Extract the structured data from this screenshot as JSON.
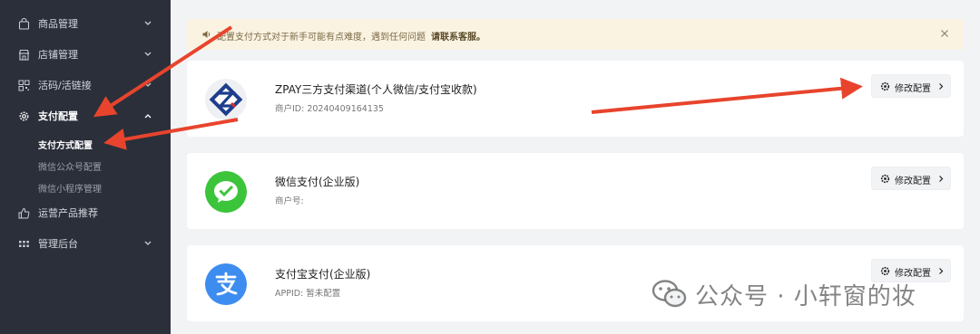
{
  "sidebar": {
    "items": [
      {
        "label": "商品管理",
        "icon": "bag-icon"
      },
      {
        "label": "店铺管理",
        "icon": "store-icon"
      },
      {
        "label": "活码/活链接",
        "icon": "qr-icon"
      },
      {
        "label": "支付配置",
        "icon": "gear-icon"
      },
      {
        "label": "运营产品推荐",
        "icon": "thumbs-up-icon"
      },
      {
        "label": "管理后台",
        "icon": "grid-icon"
      }
    ],
    "submenu": [
      {
        "label": "支付方式配置"
      },
      {
        "label": "微信公众号配置"
      },
      {
        "label": "微信小程序管理"
      }
    ]
  },
  "notice": {
    "text": "配置支付方式对于新手可能有点难度，遇到任何问题",
    "link": "请联系客服。"
  },
  "payments": [
    {
      "title": "ZPAY三方支付渠道(个人微信/支付宝收款)",
      "subtitle": "商户ID: 20240409164135",
      "button": "修改配置",
      "logo": "zpay-logo"
    },
    {
      "title": "微信支付(企业版)",
      "subtitle": "商户号:",
      "button": "修改配置",
      "logo": "wechat-pay-logo"
    },
    {
      "title": "支付宝支付(企业版)",
      "subtitle": "APPID: 暂未配置",
      "button": "修改配置",
      "logo": "alipay-logo"
    }
  ],
  "watermark": {
    "text": "公众号 · 小轩窗的妆"
  },
  "colors": {
    "sidebar_bg": "#2b2f3a",
    "notice_bg": "#fbf3e2",
    "arrow": "#e8442d",
    "wechat_green": "#3cc43b",
    "alipay_blue": "#3d8cf0"
  }
}
